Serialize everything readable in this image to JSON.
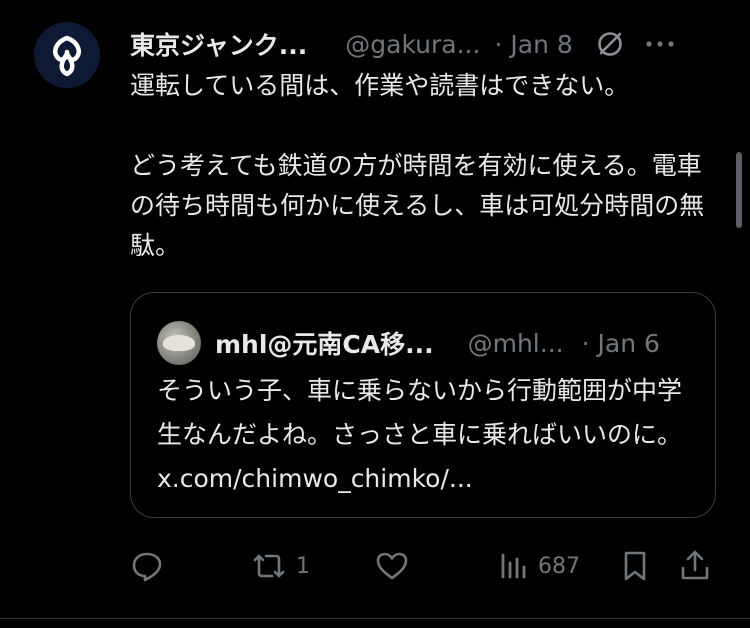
{
  "post": {
    "author": {
      "display_name": "東京ジャンク...",
      "handle": "@gakura...",
      "avatar_icon": "tokyo-emblem-icon"
    },
    "separator": "·",
    "date": "Jan 8",
    "text": "運転している間は、作業や読書はできない。\n\nどう考えても鉄道の方が時間を有効に使える。電車の待ち時間も何かに使えるし、車は可処分時間の無駄。",
    "quote": {
      "author": {
        "display_name": "mhl@元南CA移...",
        "handle": "@mhl...",
        "avatar_icon": "cat-photo-avatar"
      },
      "separator": "·",
      "date": "Jan 6",
      "text": "そういう子、車に乗らないから行動範囲が中学生なんだよね。さっさと車に乗ればいいのに。",
      "link": "x.com/chimwo_chimko/..."
    },
    "actions": {
      "reply_icon": "speech-bubble-icon",
      "repost_icon": "repost-arrows-icon",
      "repost_count": "1",
      "like_icon": "heart-icon",
      "views_icon": "bar-chart-icon",
      "views_count": "687",
      "bookmark_icon": "bookmark-icon",
      "share_icon": "share-icon"
    }
  },
  "colors": {
    "background": "#000000",
    "primary_text": "#e7e9ea",
    "secondary_text": "#71767b",
    "border": "#3a3d41"
  }
}
